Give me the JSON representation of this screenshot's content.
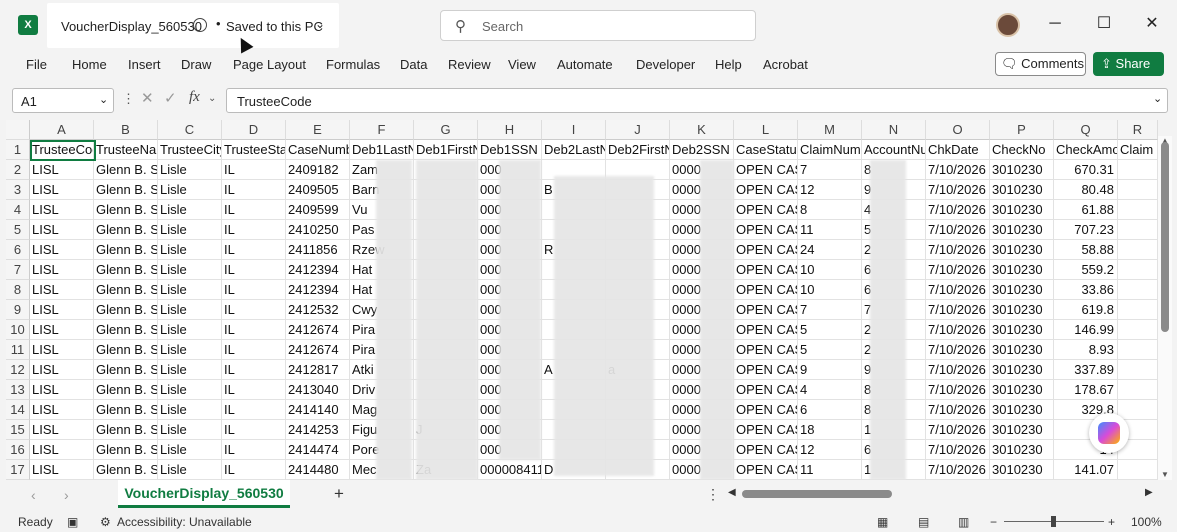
{
  "app": {
    "name": "Excel",
    "logo_letter": "X"
  },
  "title": {
    "doc_name": "VoucherDisplay_560530",
    "save_dot": "•",
    "save_status": "Saved to this PC"
  },
  "search": {
    "placeholder": "Search"
  },
  "window": {
    "minimize": "─",
    "maximize": "☐",
    "close": "✕"
  },
  "ribbon": {
    "tabs": [
      "File",
      "Home",
      "Insert",
      "Draw",
      "Page Layout",
      "Formulas",
      "Data",
      "Review",
      "View",
      "Automate",
      "Developer",
      "Help",
      "Acrobat"
    ],
    "comments": "Comments",
    "share": "Share"
  },
  "formula_bar": {
    "name_box": "A1",
    "fx": "fx",
    "value": "TrusteeCode"
  },
  "grid": {
    "columns": [
      "A",
      "B",
      "C",
      "D",
      "E",
      "F",
      "G",
      "H",
      "I",
      "J",
      "K",
      "L",
      "M",
      "N",
      "O",
      "P",
      "Q",
      "R"
    ],
    "headers": [
      "TrusteeCode",
      "TrusteeName",
      "TrusteeCity",
      "TrusteeState",
      "CaseNumber",
      "Deb1LastName",
      "Deb1FirstName",
      "Deb1SSN",
      "Deb2LastName",
      "Deb2FirstName",
      "Deb2SSN",
      "CaseStatus",
      "ClaimNumber",
      "AccountNumber",
      "ChkDate",
      "CheckNo",
      "CheckAmount",
      "Claim"
    ],
    "rows": [
      [
        "LISL",
        "Glenn B. S",
        "Lisle",
        "IL",
        "2409182",
        "Zam",
        "",
        "000",
        "",
        "",
        "0000",
        "OPEN CAS",
        "7",
        "8",
        "7/10/2026",
        "3010230",
        "670.31",
        ""
      ],
      [
        "LISL",
        "Glenn B. S",
        "Lisle",
        "IL",
        "2409505",
        "Barn",
        "",
        "000",
        "B",
        "",
        "0000",
        "OPEN CAS",
        "12",
        "9",
        "7/10/2026",
        "3010230",
        "80.48",
        ""
      ],
      [
        "LISL",
        "Glenn B. S",
        "Lisle",
        "IL",
        "2409599",
        "Vu",
        "",
        "000",
        "",
        "",
        "0000",
        "OPEN CAS",
        "8",
        "4",
        "7/10/2026",
        "3010230",
        "61.88",
        ""
      ],
      [
        "LISL",
        "Glenn B. S",
        "Lisle",
        "IL",
        "2410250",
        "Pas",
        "",
        "000",
        "",
        "",
        "0000",
        "OPEN CAS",
        "11",
        "5",
        "7/10/2026",
        "3010230",
        "707.23",
        ""
      ],
      [
        "LISL",
        "Glenn B. S",
        "Lisle",
        "IL",
        "2411856",
        "Rzew",
        "",
        "000",
        "R",
        "",
        "0000",
        "OPEN CAS",
        "24",
        "2",
        "7/10/2026",
        "3010230",
        "58.88",
        ""
      ],
      [
        "LISL",
        "Glenn B. S",
        "Lisle",
        "IL",
        "2412394",
        "Hat",
        "",
        "000",
        "",
        "",
        "0000",
        "OPEN CAS",
        "10",
        "6",
        "7/10/2026",
        "3010230",
        "559.2",
        ""
      ],
      [
        "LISL",
        "Glenn B. S",
        "Lisle",
        "IL",
        "2412394",
        "Hat",
        "",
        "000",
        "",
        "",
        "0000",
        "OPEN CAS",
        "10",
        "6",
        "7/10/2026",
        "3010230",
        "33.86",
        ""
      ],
      [
        "LISL",
        "Glenn B. S",
        "Lisle",
        "IL",
        "2412532",
        "Cwy",
        "",
        "000",
        "",
        "",
        "0000",
        "OPEN CAS",
        "7",
        "7",
        "7/10/2026",
        "3010230",
        "619.8",
        ""
      ],
      [
        "LISL",
        "Glenn B. S",
        "Lisle",
        "IL",
        "2412674",
        "Pira",
        "",
        "000",
        "",
        "",
        "0000",
        "OPEN CAS",
        "5",
        "2",
        "7/10/2026",
        "3010230",
        "146.99",
        ""
      ],
      [
        "LISL",
        "Glenn B. S",
        "Lisle",
        "IL",
        "2412674",
        "Pira",
        "",
        "000",
        "",
        "",
        "0000",
        "OPEN CAS",
        "5",
        "2",
        "7/10/2026",
        "3010230",
        "8.93",
        ""
      ],
      [
        "LISL",
        "Glenn B. S",
        "Lisle",
        "IL",
        "2412817",
        "Atki",
        "",
        "000",
        "A",
        "a",
        "0000",
        "OPEN CAS",
        "9",
        "9",
        "7/10/2026",
        "3010230",
        "337.89",
        ""
      ],
      [
        "LISL",
        "Glenn B. S",
        "Lisle",
        "IL",
        "2413040",
        "Driv",
        "",
        "000",
        "",
        "",
        "0000",
        "OPEN CAS",
        "4",
        "8",
        "7/10/2026",
        "3010230",
        "178.67",
        ""
      ],
      [
        "LISL",
        "Glenn B. S",
        "Lisle",
        "IL",
        "2414140",
        "Mag",
        "",
        "000",
        "",
        "",
        "0000",
        "OPEN CAS",
        "6",
        "8",
        "7/10/2026",
        "3010230",
        "329.8",
        ""
      ],
      [
        "LISL",
        "Glenn B. S",
        "Lisle",
        "IL",
        "2414253",
        "Figu",
        "J",
        "000",
        "",
        "",
        "0000",
        "OPEN CAS",
        "18",
        "1",
        "7/10/2026",
        "3010230",
        "30",
        ""
      ],
      [
        "LISL",
        "Glenn B. S",
        "Lisle",
        "IL",
        "2414474",
        "Pore",
        "",
        "000",
        "",
        "",
        "0000",
        "OPEN CAS",
        "12",
        "6",
        "7/10/2026",
        "3010230",
        "14",
        ""
      ],
      [
        "LISL",
        "Glenn B. S",
        "Lisle",
        "IL",
        "2414480",
        "Mec",
        "Za",
        "000008411",
        "D",
        "",
        "0000",
        "OPEN CAS",
        "11",
        "1",
        "7/10/2026",
        "3010230",
        "141.07",
        ""
      ]
    ]
  },
  "sheet_tabs": {
    "active": "VoucherDisplay_560530",
    "add": "+",
    "more": "⋮"
  },
  "status": {
    "ready": "Ready",
    "accessibility": "Accessibility: Unavailable",
    "zoom": "100%",
    "zoom_minus": "−",
    "zoom_plus": "+"
  }
}
